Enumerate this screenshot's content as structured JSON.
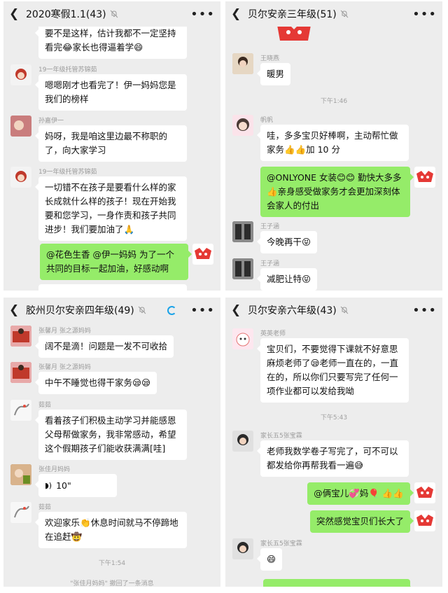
{
  "colors": {
    "chat_bg": "#ededed",
    "incoming": "#ffffff",
    "outgoing": "#95ec69",
    "meta_text": "#9b9b9b"
  },
  "panels": [
    {
      "title": "2020寒假1.1(43)",
      "messages": [
        {
          "text": "要不是这样，估计我都不一定坚持看完😂家长也得逼着学😄"
        },
        {
          "sender": "19一年级托管苏锦茹",
          "text": "嗯嗯刚才也看完了！伊一妈妈您是我们的榜样"
        },
        {
          "sender": "孙嘉伊一",
          "text": "妈呀，我是咱这里边最不称职的了，向大家学习"
        },
        {
          "sender": "19一年级托管苏锦茹",
          "text": "一切错不在孩子是要看什么样的家长成就什么样的孩子！现在开始我要和您学习，一身作责和孩子共同进步！我们要加油了🙏"
        },
        {
          "text": "@花色生香  @伊一妈妈  为了一个共同的目标一起加油，好感动啊"
        }
      ]
    },
    {
      "title": "贝尔安亲三年级(51)",
      "messages": [
        {
          "sender": "王晓燕",
          "text": "暖男"
        },
        {
          "time": "下午1:46"
        },
        {
          "sender": "帆帆",
          "text": "哇，多多宝贝好棒啊，主动帮忙做家务👍👍加 10 分"
        },
        {
          "text": "@ONLYONE 女装😊😊  勤快大多多👍亲身感受做家务才会更加深刻体会家人的付出"
        },
        {
          "sender": "王子涵",
          "text": "今晚再干😝"
        },
        {
          "sender": "王子涵",
          "text": "减肥让特😝"
        }
      ]
    },
    {
      "title": "胶州贝尔安亲四年级(49)",
      "messages": [
        {
          "sender": "张馨月 张之源妈妈",
          "text": "阔不是滴！问题是一发不可收拾"
        },
        {
          "sender": "张馨月 张之源妈妈",
          "text": "中午不睡觉也得干家务😪😪"
        },
        {
          "sender": "茹茹",
          "text": "看着孩子们积极主动学习并能感恩父母帮做家务，我非常感动，希望这个假期孩子们能收获满满[哇]"
        },
        {
          "sender": "张佳月妈妈",
          "text": "10\""
        },
        {
          "sender": "茹茹",
          "text": "欢迎家乐👏休息时间就马不停蹄地在追赶🤠"
        },
        {
          "time": "下午1:54"
        },
        {
          "recall": "\"张佳月妈妈\" 撤回了一条消息"
        }
      ]
    },
    {
      "title": "贝尔安亲六年级(43)",
      "messages": [
        {
          "sender": "英英老师",
          "text": "宝贝们，不要觉得下课就不好意思麻烦老师了😪老师一直在的，一直在的，所以你们只要写完了任何一项作业都可以发给我呦"
        },
        {
          "time": "下午5:43"
        },
        {
          "sender": "家长五5张宝霖",
          "text": "老师我数学卷子写完了，可不可以都发给你再帮我看一遍😅"
        },
        {
          "text": "@俩宝儿💞妈🎈 👍👍"
        },
        {
          "text": "突然感觉宝贝们长大了"
        },
        {
          "sender": "家长五5张宝霖",
          "text": "😄"
        }
      ]
    }
  ]
}
